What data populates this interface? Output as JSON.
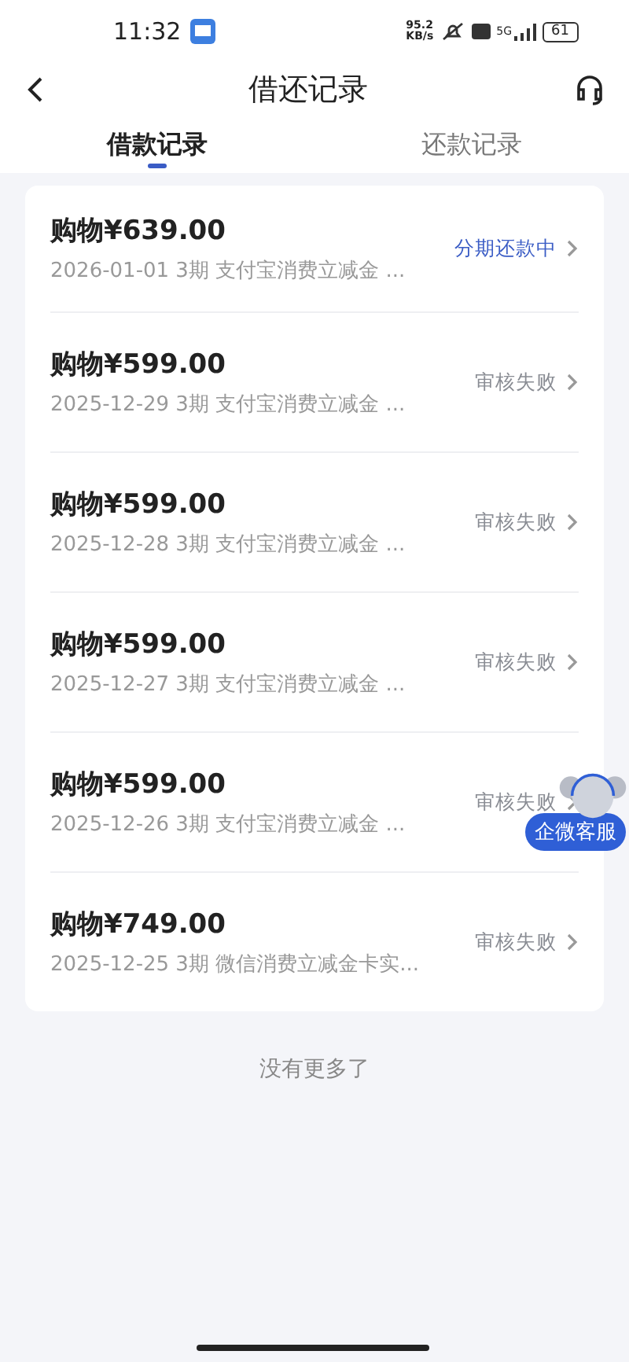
{
  "status_bar": {
    "time": "11:32",
    "speed": "95.2",
    "speed_unit": "KB/s",
    "network": "5G",
    "battery": "61"
  },
  "header": {
    "title": "借还记录"
  },
  "tabs": [
    {
      "label": "借款记录",
      "selected": true
    },
    {
      "label": "还款记录",
      "selected": false
    }
  ],
  "records": [
    {
      "title": "购物¥639.00",
      "detail": "2026-01-01 3期  支付宝消费立减金 ...",
      "status": "分期还款中",
      "kind": "active"
    },
    {
      "title": "购物¥599.00",
      "detail": "2025-12-29 3期  支付宝消费立减金 ...",
      "status": "审核失败",
      "kind": "failed"
    },
    {
      "title": "购物¥599.00",
      "detail": "2025-12-28 3期  支付宝消费立减金 ...",
      "status": "审核失败",
      "kind": "failed"
    },
    {
      "title": "购物¥599.00",
      "detail": "2025-12-27 3期  支付宝消费立减金 ...",
      "status": "审核失败",
      "kind": "failed"
    },
    {
      "title": "购物¥599.00",
      "detail": "2025-12-26 3期  支付宝消费立减金 ...",
      "status": "审核失败",
      "kind": "failed"
    },
    {
      "title": "购物¥749.00",
      "detail": "2025-12-25 3期  微信消费立减金卡实...",
      "status": "审核失败",
      "kind": "failed"
    }
  ],
  "end_note": "没有更多了",
  "support_button": {
    "label": "企微客服"
  }
}
